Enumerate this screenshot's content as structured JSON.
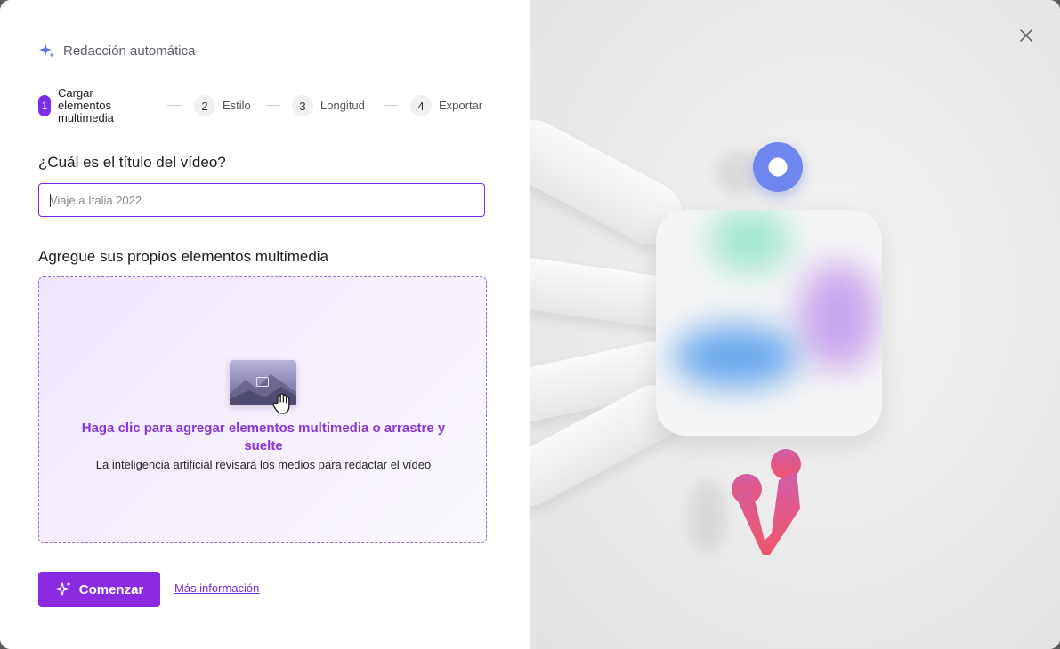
{
  "app": {
    "title": "Redacción automática"
  },
  "stepper": {
    "steps": [
      {
        "number": "1",
        "label": "Cargar elementos multimedia",
        "active": true
      },
      {
        "number": "2",
        "label": "Estilo",
        "active": false
      },
      {
        "number": "3",
        "label": "Longitud",
        "active": false
      },
      {
        "number": "4",
        "label": "Exportar",
        "active": false
      }
    ]
  },
  "form": {
    "title_question": "¿Cuál es el título del vídeo?",
    "title_placeholder": "Viaje a Italia 2022",
    "title_value": "",
    "media_heading": "Agregue sus propios elementos multimedia"
  },
  "dropzone": {
    "main_text": "Haga clic para agregar elementos multimedia o arrastre y suelte",
    "sub_text": "La inteligencia artificial revisará los medios para redactar el vídeo"
  },
  "actions": {
    "start_label": "Comenzar",
    "more_info_label": "Más información"
  },
  "icons": {
    "header": "sparkle-icon",
    "start": "sparkle-icon",
    "close": "close-icon",
    "hand": "hand-cursor-icon"
  },
  "colors": {
    "accent": "#8a2be2",
    "link": "#7b2ce6",
    "dropzone_text": "#8a35d6"
  }
}
